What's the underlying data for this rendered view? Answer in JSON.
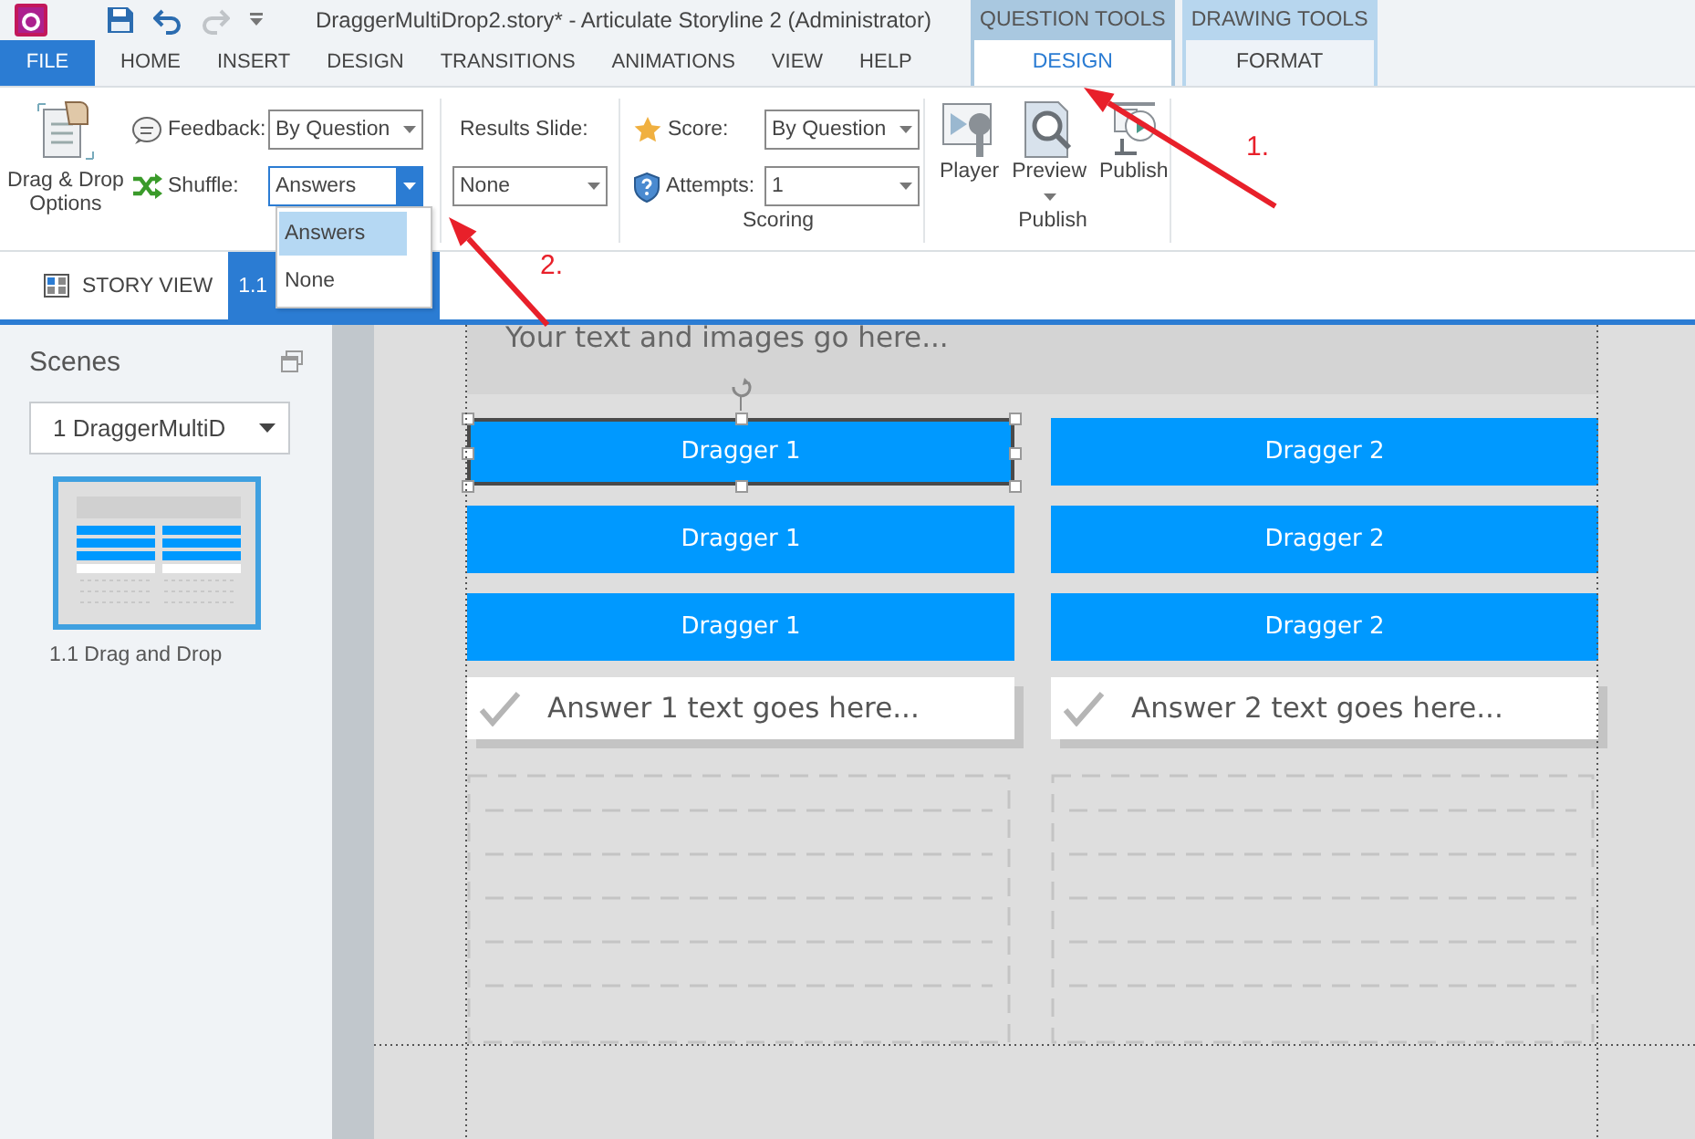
{
  "window": {
    "title": "DraggerMultiDrop2.story* -  Articulate Storyline 2 (Administrator)"
  },
  "menu_tabs": [
    {
      "label": "FILE",
      "kind": "file",
      "selected": false
    },
    {
      "label": "HOME",
      "kind": "tab",
      "selected": false
    },
    {
      "label": "INSERT",
      "kind": "tab",
      "selected": false
    },
    {
      "label": "DESIGN",
      "kind": "tab",
      "selected": false
    },
    {
      "label": "TRANSITIONS",
      "kind": "tab",
      "selected": false
    },
    {
      "label": "ANIMATIONS",
      "kind": "tab",
      "selected": false
    },
    {
      "label": "VIEW",
      "kind": "tab",
      "selected": false
    },
    {
      "label": "HELP",
      "kind": "tab",
      "selected": false
    }
  ],
  "contextual_groups": [
    {
      "label": "QUESTION TOOLS",
      "tab": {
        "label": "DESIGN",
        "selected": true
      }
    },
    {
      "label": "DRAWING TOOLS",
      "tab": {
        "label": "FORMAT",
        "selected": false
      }
    }
  ],
  "ribbon": {
    "drag_drop_button": "Drag & Drop Options",
    "feedback": {
      "label": "Feedback:",
      "value": "By Question"
    },
    "shuffle": {
      "label": "Shuffle:",
      "value": "Answers",
      "expanded": true,
      "options": [
        {
          "label": "Answers",
          "selected": true
        },
        {
          "label": "None",
          "selected": false
        }
      ]
    },
    "results_slide": {
      "label": "Results Slide:",
      "value": "None"
    },
    "score": {
      "label": "Score:",
      "value": "By Question"
    },
    "attempts": {
      "label": "Attempts:",
      "value": "1"
    },
    "scoring_group": "Scoring",
    "publish_buttons": [
      {
        "label": "Player",
        "kind": "player"
      },
      {
        "label": "Preview",
        "kind": "preview"
      },
      {
        "label": "Publish",
        "kind": "publish"
      }
    ],
    "publish_group": "Publish"
  },
  "view_tabs": [
    {
      "label": "STORY VIEW",
      "selected": false
    },
    {
      "label": "1.1",
      "selected": true
    }
  ],
  "sidebar": {
    "title": "Scenes",
    "scene_select": "1 DraggerMultiD",
    "slides": [
      {
        "label": "1.1 Drag and Drop",
        "selected": true
      }
    ]
  },
  "slide": {
    "title_placeholder": "Your text and images go here...",
    "columns": [
      {
        "draggers": [
          {
            "label": "Dragger 1",
            "selected": true
          },
          {
            "label": "Dragger 1",
            "selected": false
          },
          {
            "label": "Dragger 1",
            "selected": false
          }
        ],
        "answer": "Answer 1 text goes here..."
      },
      {
        "draggers": [
          {
            "label": "Dragger 2",
            "selected": false
          },
          {
            "label": "Dragger 2",
            "selected": false
          },
          {
            "label": "Dragger 2",
            "selected": false
          }
        ],
        "answer": "Answer 2 text goes here..."
      }
    ]
  },
  "annotations": [
    {
      "label": "1."
    },
    {
      "label": "2."
    }
  ]
}
